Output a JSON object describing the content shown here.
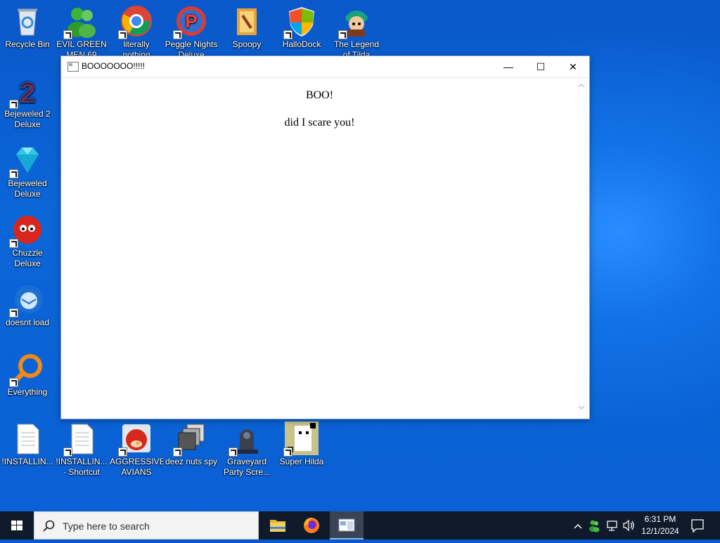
{
  "desktop": {
    "icons": [
      {
        "label": "Recycle Bin"
      },
      {
        "label": "EVIL GREEN MEN 69"
      },
      {
        "label": "literally nothing"
      },
      {
        "label": "Peggle Nights Deluxe"
      },
      {
        "label": "Spoopy"
      },
      {
        "label": "HalloDock"
      },
      {
        "label": "The Legend of Tilda"
      },
      {
        "label": "Bejeweled 2 Deluxe"
      },
      {
        "label": "Bejeweled Deluxe"
      },
      {
        "label": "Chuzzle Deluxe"
      },
      {
        "label": "doesnt load"
      },
      {
        "label": "Everything"
      },
      {
        "label": "!INSTALLIN..."
      },
      {
        "label": "!INSTALLIN... - Shortcut"
      },
      {
        "label": "AGGRESSIVE AVIANS"
      },
      {
        "label": "deez nuts spy"
      },
      {
        "label": "Graveyard Party Scre..."
      },
      {
        "label": "Super Hilda"
      }
    ]
  },
  "window": {
    "title": "BOOOOOOO!!!!!",
    "minimize": "—",
    "maximize": "☐",
    "close": "✕",
    "heading": "BOO!",
    "message": "did I scare you!"
  },
  "taskbar": {
    "search_placeholder": "Type here to search",
    "time": "6:31 PM",
    "date": "12/1/2024"
  },
  "colors": {
    "desktop_blue": "#0b66d8",
    "taskbar": "#0f1a2b"
  }
}
